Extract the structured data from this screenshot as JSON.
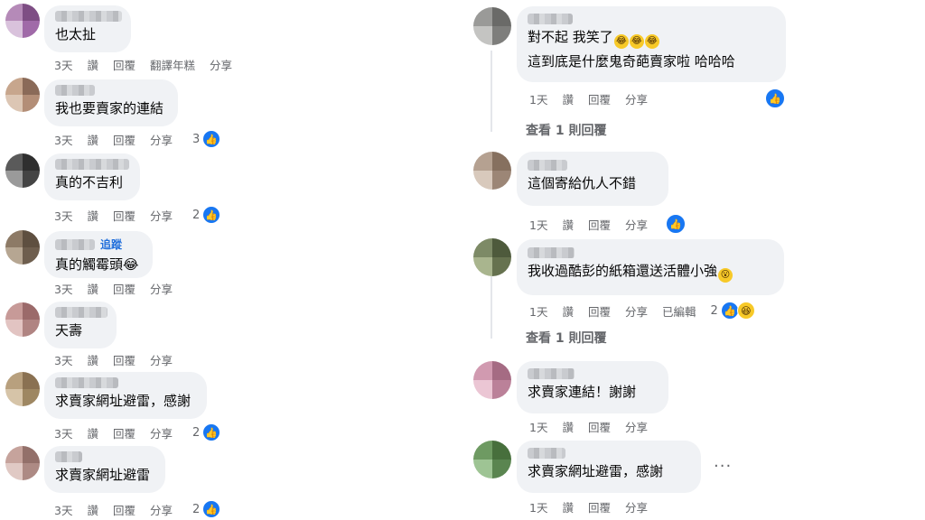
{
  "left": [
    {
      "text": "也太扯",
      "actions": [
        "3天",
        "讚",
        "回覆",
        "翻譯年糕",
        "分享"
      ],
      "count": "",
      "colors": [
        "#b58ab8",
        "#7e4e84",
        "#d9c2dc",
        "#a06aa8"
      ]
    },
    {
      "text": "我也要賣家的連結",
      "actions": [
        "3天",
        "讚",
        "回覆",
        "分享"
      ],
      "count": "3",
      "colors": [
        "#c7a68d",
        "#8a6a58",
        "#dcc6b4",
        "#b38e77"
      ]
    },
    {
      "text": "真的不吉利",
      "actions": [
        "3天",
        "讚",
        "回覆",
        "分享"
      ],
      "count": "2",
      "colors": [
        "#5a5a5a",
        "#2f2f2f",
        "#9a9a9a",
        "#444444"
      ]
    },
    {
      "text": "真的觸霉頭😂",
      "follow": "追蹤",
      "actions": [
        "3天",
        "讚",
        "回覆",
        "分享"
      ],
      "count": "",
      "colors": [
        "#8d7a66",
        "#5e4f40",
        "#b6a692",
        "#6e5e4e"
      ]
    },
    {
      "text": "天壽",
      "actions": [
        "3天",
        "讚",
        "回覆",
        "分享"
      ],
      "count": "",
      "colors": [
        "#c79a98",
        "#9b6a6a",
        "#e2c4c2",
        "#b08482"
      ]
    },
    {
      "text": "求賣家網址避雷，感謝",
      "actions": [
        "3天",
        "讚",
        "回覆",
        "分享"
      ],
      "count": "2",
      "colors": [
        "#b8a07e",
        "#8a7152",
        "#d6c4a8",
        "#9e8762"
      ]
    },
    {
      "text": "求賣家網址避雷",
      "actions": [
        "3天",
        "讚",
        "回覆",
        "分享"
      ],
      "count": "2",
      "colors": [
        "#c6a39c",
        "#93706a",
        "#e0c9c4",
        "#ad8a84"
      ]
    }
  ],
  "right": [
    {
      "line1": "對不起 我笑了",
      "line2": "這到底是什麼鬼奇葩賣家啦 哈哈哈",
      "actions": [
        "1天",
        "讚",
        "回覆",
        "分享"
      ],
      "count": "",
      "colors": [
        "#9a9a98",
        "#6a6a68",
        "#c4c4c2",
        "#7e7e7c"
      ]
    },
    {
      "text": "這個寄給仇人不錯",
      "actions": [
        "1天",
        "讚",
        "回覆",
        "分享"
      ],
      "count": "",
      "colors": [
        "#b5a191",
        "#86705f",
        "#d8c9bc",
        "#9c8676"
      ]
    },
    {
      "text": "我收過酷彭的紙箱還送活體小強",
      "actions": [
        "1天",
        "讚",
        "回覆",
        "分享",
        "已編輯"
      ],
      "count": "2",
      "colors": [
        "#7d8a66",
        "#4e5a3c",
        "#a9b58e",
        "#66724f"
      ]
    },
    {
      "text": "求賣家連結！謝謝",
      "actions": [
        "1天",
        "讚",
        "回覆",
        "分享"
      ],
      "count": "",
      "colors": [
        "#d19ab0",
        "#a56b83",
        "#ebc6d4",
        "#bb8199"
      ]
    },
    {
      "text": "求賣家網址避雷，感謝",
      "actions": [
        "1天",
        "讚",
        "回覆",
        "分享"
      ],
      "count": "",
      "colors": [
        "#6e9a62",
        "#476f3c",
        "#9ec494",
        "#5a8550"
      ]
    }
  ],
  "view_replies": [
    "查看 1 則回覆",
    "查看 1 則回覆"
  ],
  "more_label": "···",
  "icons": {
    "like": "thumbs-up-icon",
    "haha": "laughing-emoji-icon"
  },
  "accent": "#1877f2"
}
